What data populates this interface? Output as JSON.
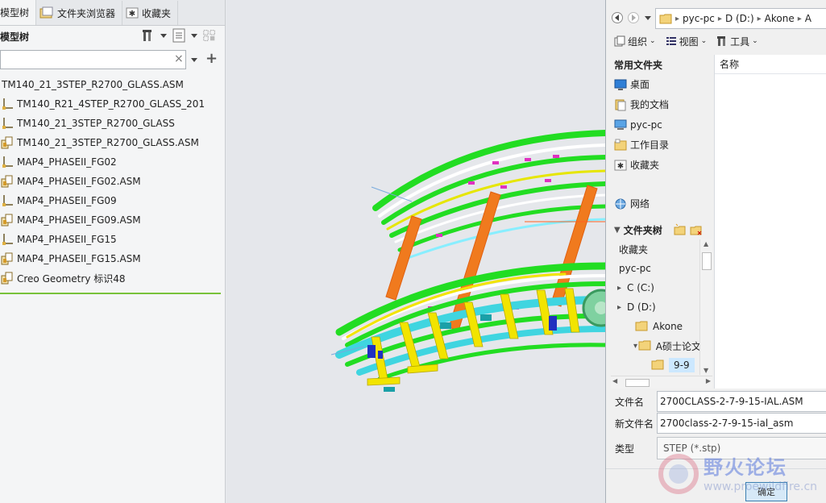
{
  "left_panel": {
    "tabs": [
      {
        "label": "模型树",
        "icon": "model-tree-icon"
      },
      {
        "label": "文件夹浏览器",
        "icon": "folder-browser-icon"
      },
      {
        "label": "收藏夹",
        "icon": "favorites-icon"
      }
    ],
    "tree_title": "模型树",
    "search": {
      "value": "",
      "placeholder": ""
    },
    "tree_items": [
      {
        "label": "TM140_21_3STEP_R2700_GLASS.ASM",
        "icon": "none"
      },
      {
        "label": "TM140_R21_4STEP_R2700_GLASS_201",
        "icon": "part-icon"
      },
      {
        "label": "TM140_21_3STEP_R2700_GLASS",
        "icon": "part-icon"
      },
      {
        "label": "TM140_21_3STEP_R2700_GLASS.ASM",
        "icon": "assembly-icon"
      },
      {
        "label": "MAP4_PHASEII_FG02",
        "icon": "part-icon"
      },
      {
        "label": "MAP4_PHASEII_FG02.ASM",
        "icon": "assembly-icon"
      },
      {
        "label": "MAP4_PHASEII_FG09",
        "icon": "part-icon"
      },
      {
        "label": "MAP4_PHASEII_FG09.ASM",
        "icon": "assembly-icon"
      },
      {
        "label": "MAP4_PHASEII_FG15",
        "icon": "part-icon"
      },
      {
        "label": "MAP4_PHASEII_FG15.ASM",
        "icon": "assembly-icon"
      },
      {
        "label": "Creo Geometry 标识48",
        "icon": "assembly-icon"
      }
    ]
  },
  "dialog": {
    "breadcrumb": [
      "pyc-pc",
      "D (D:)",
      "Akone",
      "A"
    ],
    "toolbar": {
      "organize": "组织",
      "view": "视图",
      "tools": "工具"
    },
    "favorites_title": "常用文件夹",
    "favorites": [
      {
        "label": "桌面",
        "icon": "desktop-icon"
      },
      {
        "label": "我的文档",
        "icon": "documents-icon"
      },
      {
        "label": "pyc-pc",
        "icon": "computer-icon"
      },
      {
        "label": "工作目录",
        "icon": "working-dir-icon"
      },
      {
        "label": "收藏夹",
        "icon": "favorites-icon"
      }
    ],
    "network": "网络",
    "column_name": "名称",
    "folder_tree_title": "文件夹树",
    "folder_tree": [
      {
        "label": "收藏夹",
        "indent": 0,
        "expander": ""
      },
      {
        "label": "pyc-pc",
        "indent": 0,
        "expander": ""
      },
      {
        "label": "C (C:)",
        "indent": 1,
        "expander": "▸"
      },
      {
        "label": "D (D:)",
        "indent": 1,
        "expander": "▸"
      },
      {
        "label": "Akone",
        "indent": 2,
        "expander": ""
      },
      {
        "label": "A硕士论文",
        "indent": 3,
        "expander": "▾"
      },
      {
        "label": "9-9",
        "indent": 4,
        "expander": "",
        "selected": true
      }
    ],
    "file_name_label": "文件名",
    "file_name_value": "2700CLASS-2-7-9-15-IAL.ASM",
    "new_name_label": "新文件名",
    "new_name_value": "2700class-2-7-9-15-ial_asm",
    "type_label": "类型",
    "type_value": "STEP (*.stp)",
    "ok_label": "确定"
  },
  "watermark": {
    "text": "野火论坛",
    "url": "www.proewildfire.cn"
  },
  "colors": {
    "accent_green": "#79c23a",
    "beam_orange": "#f07a1e",
    "rail_green": "#22dd22",
    "support_yellow": "#f2e400",
    "base_cyan": "#3fd5e0"
  }
}
